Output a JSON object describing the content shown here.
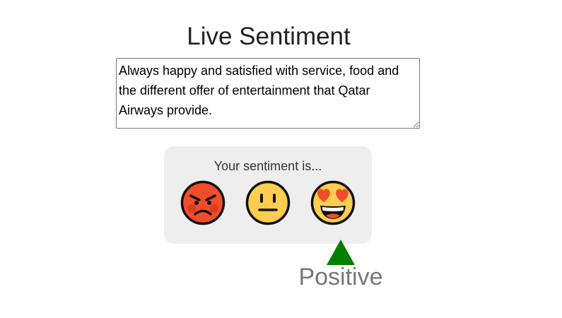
{
  "page": {
    "title": "Live Sentiment"
  },
  "input": {
    "value": "Always happy and satisfied with service, food and the different offer of entertainment that Qatar Airways provide."
  },
  "sentiment_panel": {
    "label": "Your sentiment is...",
    "options": [
      {
        "icon": "angry-face-icon",
        "color": "#f04e2a"
      },
      {
        "icon": "neutral-face-icon",
        "color": "#ffcd4f"
      },
      {
        "icon": "heart-eyes-face-icon",
        "color": "#ffcd4f"
      }
    ],
    "selected_index": 2
  },
  "result": {
    "label": "Positive",
    "indicator_icon": "up-triangle-icon",
    "indicator_color": "#008000"
  }
}
